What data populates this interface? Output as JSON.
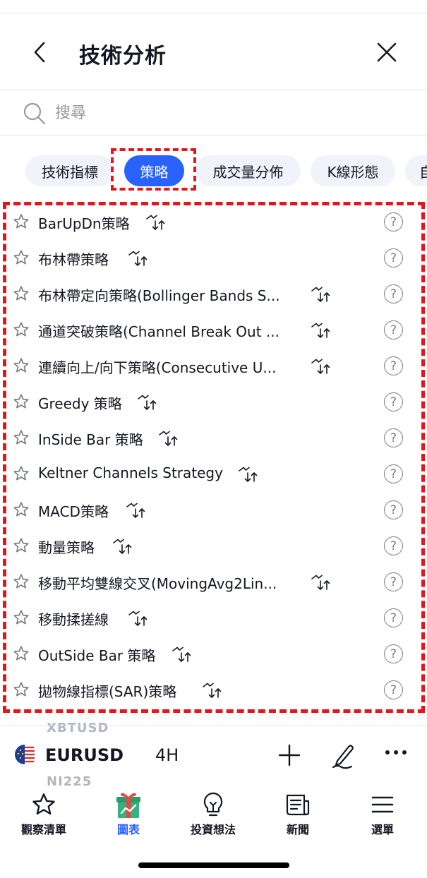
{
  "header": {
    "title": "技術分析"
  },
  "search": {
    "placeholder": "搜尋"
  },
  "chips": [
    {
      "label": "技術指標"
    },
    {
      "label": "策略"
    },
    {
      "label": "成交量分佈"
    },
    {
      "label": "K線形態"
    },
    {
      "label": "自"
    }
  ],
  "strategies": [
    {
      "name": "BarUpDn策略"
    },
    {
      "name": "布林帶策略"
    },
    {
      "name": "布林帶定向策略(Bollinger Bands S..."
    },
    {
      "name": "通道突破策略(Channel Break Out ..."
    },
    {
      "name": "連續向上/向下策略(Consecutive U..."
    },
    {
      "name": "Greedy 策略"
    },
    {
      "name": "InSide Bar 策略"
    },
    {
      "name": "Keltner Channels Strategy"
    },
    {
      "name": "MACD策略"
    },
    {
      "name": "動量策略"
    },
    {
      "name": "移動平均雙線交叉(MovingAvg2Lin..."
    },
    {
      "name": "移動揉搓線"
    },
    {
      "name": "OutSide Bar 策略"
    },
    {
      "name": "拋物線指標(SAR)策略"
    }
  ],
  "help_glyph": "?",
  "underlay": {
    "top": "XBTUSD",
    "bottom": "NI225"
  },
  "symbol_bar": {
    "symbol": "EURUSD",
    "interval": "4H"
  },
  "tabs": [
    {
      "label": "觀察清單"
    },
    {
      "label": "圖表"
    },
    {
      "label": "投資想法"
    },
    {
      "label": "新聞"
    },
    {
      "label": "選單"
    }
  ],
  "colors": {
    "accent": "#2962ff",
    "highlight": "#e5151c",
    "gift_red": "#e8473e",
    "gift_green": "#36b27e"
  }
}
